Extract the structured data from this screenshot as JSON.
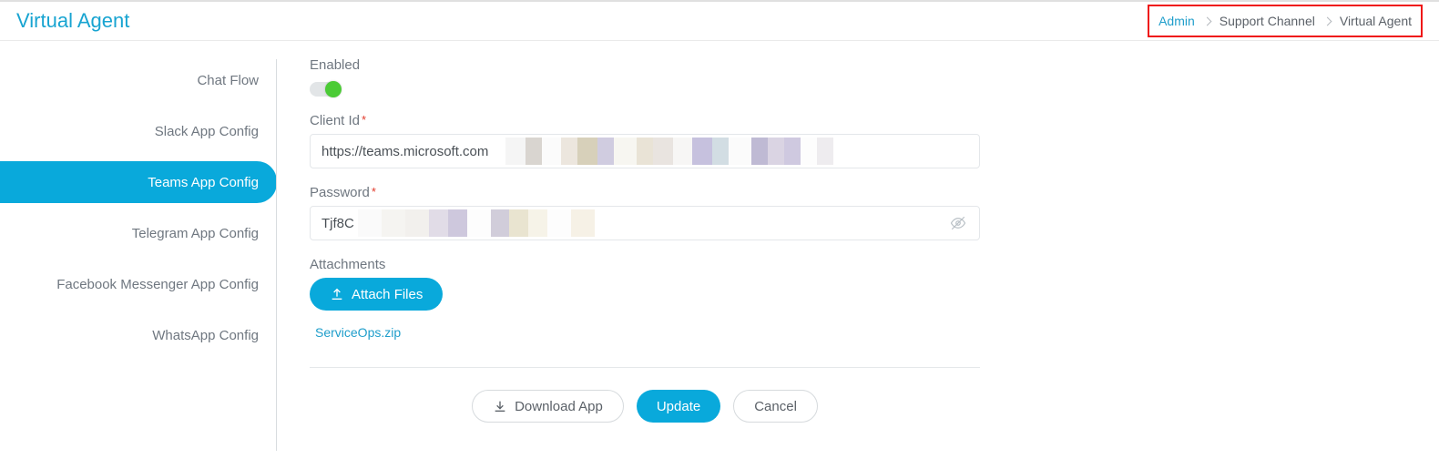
{
  "header": {
    "title": "Virtual Agent"
  },
  "breadcrumb": {
    "items": [
      {
        "label": "Admin",
        "link": true
      },
      {
        "label": "Support Channel",
        "link": false
      },
      {
        "label": "Virtual Agent",
        "link": false
      }
    ]
  },
  "sidebar": {
    "items": [
      {
        "label": "Chat Flow",
        "active": false
      },
      {
        "label": "Slack App Config",
        "active": false
      },
      {
        "label": "Teams App Config",
        "active": true
      },
      {
        "label": "Telegram App Config",
        "active": false
      },
      {
        "label": "Facebook Messenger App Config",
        "active": false
      },
      {
        "label": "WhatsApp Config",
        "active": false
      }
    ]
  },
  "form": {
    "enabled_label": "Enabled",
    "enabled_value": true,
    "client_id_label": "Client Id",
    "client_id_value": "https://teams.microsoft.com",
    "password_label": "Password",
    "password_value": "Tjf8C",
    "attachments_label": "Attachments",
    "attach_btn": "Attach Files",
    "attached_file": "ServiceOps.zip"
  },
  "actions": {
    "download": "Download App",
    "update": "Update",
    "cancel": "Cancel"
  }
}
